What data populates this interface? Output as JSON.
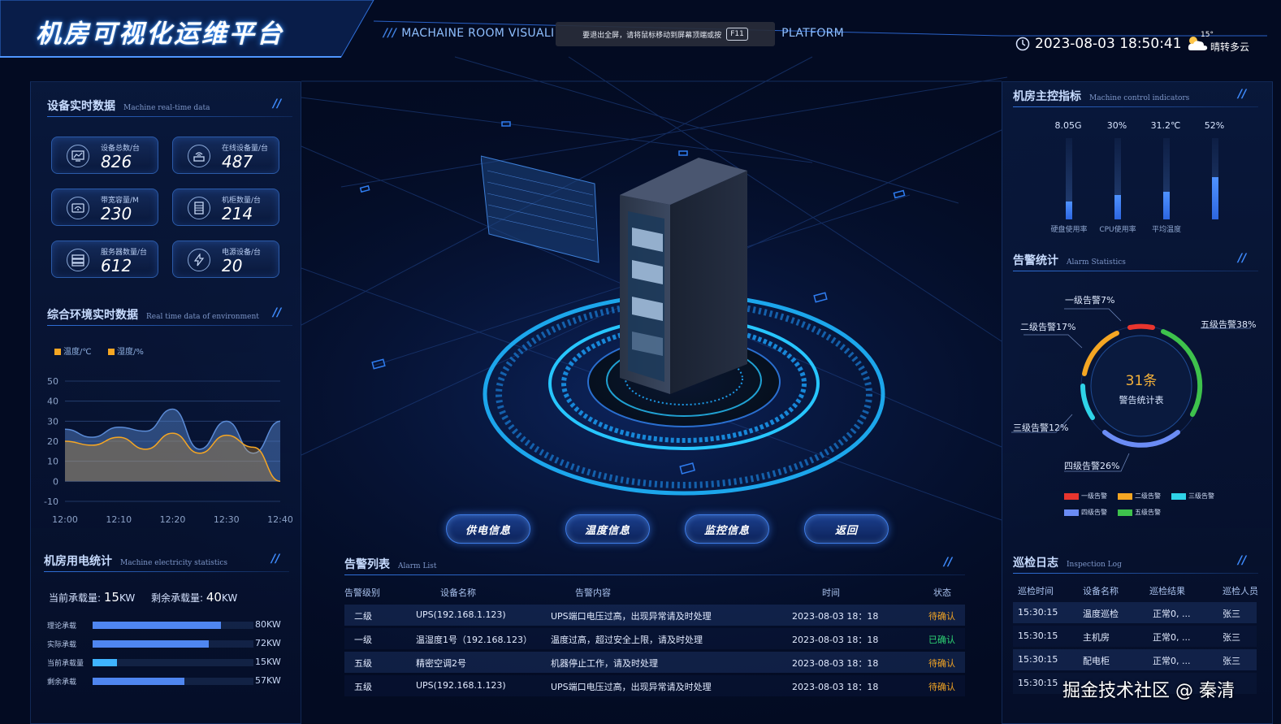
{
  "header": {
    "title": "机房可视化运维平台",
    "subtitle_left": "MACHAINE ROOM VISUALI",
    "subtitle_right": "PLATFORM",
    "fullscreen_notice": "要退出全屏，请将鼠标移动到屏幕顶端或按",
    "fullscreen_key": "F11",
    "datetime": "2023-08-03 18:50:41",
    "weather_temp": "15°",
    "weather_desc": "晴转多云"
  },
  "device_realtime": {
    "title": "设备实时数据",
    "title_en": "Machine real-time data",
    "cards": [
      {
        "label": "设备总数/台",
        "value": "826",
        "icon": "monitor-chart-icon"
      },
      {
        "label": "在线设备量/台",
        "value": "487",
        "icon": "router-icon"
      },
      {
        "label": "带宽容量/M",
        "value": "230",
        "icon": "bandwidth-icon"
      },
      {
        "label": "机柜数量/台",
        "value": "214",
        "icon": "cabinet-icon"
      },
      {
        "label": "服务器数量/台",
        "value": "612",
        "icon": "server-icon"
      },
      {
        "label": "电源设备/台",
        "value": "20",
        "icon": "power-icon"
      }
    ]
  },
  "environment": {
    "title": "综合环境实时数据",
    "title_en": "Real time data of environment",
    "legend_temp": "温度/℃",
    "legend_humidity": "湿度/%",
    "color_temp": "#f5a623",
    "color_humidity": "#5b8bd6"
  },
  "chart_data": {
    "type": "area",
    "x": [
      "12:00",
      "12:05",
      "12:10",
      "12:15",
      "12:20",
      "12:25",
      "12:30",
      "12:35",
      "12:40"
    ],
    "series": [
      {
        "name": "温度/℃",
        "values": [
          20,
          18,
          22,
          16,
          24,
          14,
          23,
          17,
          0
        ]
      },
      {
        "name": "湿度/%",
        "values": [
          26,
          22,
          27,
          25,
          36,
          16,
          30,
          14,
          30
        ]
      }
    ],
    "yticks": [
      50,
      40,
      30,
      20,
      10,
      0,
      -10
    ],
    "xticks": [
      "12:00",
      "12:10",
      "12:20",
      "12:30",
      "12:40"
    ],
    "ylim": [
      -10,
      50
    ],
    "grid": true
  },
  "electricity": {
    "title": "机房用电统计",
    "title_en": "Machine electricity statistics",
    "current_label": "当前承载量:",
    "current_value": "15",
    "current_unit": "KW",
    "remain_label": "剩余承载量:",
    "remain_value": "40",
    "remain_unit": "KW",
    "rows": [
      {
        "label": "理论承载",
        "value": 80,
        "display": "80KW",
        "color": "#4f86f0"
      },
      {
        "label": "实际承载",
        "value": 72,
        "display": "72KW",
        "color": "#4f86f0"
      },
      {
        "label": "当前承载量",
        "value": 15,
        "display": "15KW",
        "color": "#3fb4ff"
      },
      {
        "label": "剩余承载",
        "value": 57,
        "display": "57KW",
        "color": "#4f86f0"
      }
    ],
    "max": 100
  },
  "indicators": {
    "title": "机房主控指标",
    "title_en": "Machine control indicators",
    "items": [
      {
        "value": "8.05G",
        "name": "硬盘使用率",
        "fraction": 0.22
      },
      {
        "value": "30%",
        "name": "CPU使用率",
        "fraction": 0.3
      },
      {
        "value": "31.2℃",
        "name": "平均温度",
        "fraction": 0.34
      },
      {
        "value": "52%",
        "name": "",
        "fraction": 0.52
      }
    ]
  },
  "alarm_stats": {
    "title": "告警统计",
    "title_en": "Alarm Statistics",
    "total": "31条",
    "center_label": "警告统计表",
    "labels": {
      "l1": "一级告警7%",
      "l2": "二级告警17%",
      "l3": "三级告警12%",
      "l4": "四级告警26%",
      "l5": "五级告警38%"
    },
    "legend": [
      {
        "name": "一级告警",
        "color": "#e8352e"
      },
      {
        "name": "二级告警",
        "color": "#f5a623"
      },
      {
        "name": "三级告警",
        "color": "#2fd3e8"
      },
      {
        "name": "四级告警",
        "color": "#6b8cf5"
      },
      {
        "name": "五级告警",
        "color": "#3ec24c"
      }
    ]
  },
  "alarm_list": {
    "title": "告警列表",
    "title_en": "Alarm List",
    "headers": [
      "告警级别",
      "设备名称",
      "告警内容",
      "时间",
      "状态"
    ],
    "rows": [
      {
        "level": "二级",
        "device": "UPS(192.168.1.123)",
        "content": "UPS端口电压过高，出现异常请及时处理",
        "time": "2023-08-03  18：18",
        "status": "待确认",
        "done": false
      },
      {
        "level": "一级",
        "device": "温湿度1号（192.168.123）",
        "content": "温度过高，超过安全上限，请及时处理",
        "time": "2023-08-03  18：18",
        "status": "已确认",
        "done": true
      },
      {
        "level": "五级",
        "device": "精密空调2号",
        "content": "机器停止工作，请及时处理",
        "time": "2023-08-03  18：18",
        "status": "待确认",
        "done": false
      },
      {
        "level": "五级",
        "device": "UPS(192.168.1.123)",
        "content": "UPS端口电压过高，出现异常请及时处理",
        "time": "2023-08-03  18：18",
        "status": "待确认",
        "done": false
      }
    ]
  },
  "inspection": {
    "title": "巡检日志",
    "title_en": "Inspection Log",
    "headers": [
      "巡检时间",
      "设备名称",
      "巡检结果",
      "巡检人员"
    ],
    "rows": [
      {
        "time": "15:30:15",
        "device": "温度巡检",
        "result": "正常0, ...",
        "person": "张三"
      },
      {
        "time": "15:30:15",
        "device": "主机房",
        "result": "正常0, ...",
        "person": "张三"
      },
      {
        "time": "15:30:15",
        "device": "配电柜",
        "result": "正常0, ...",
        "person": "张三"
      },
      {
        "time": "15:30:15",
        "device": "",
        "result": "",
        "person": ""
      }
    ]
  },
  "buttons": {
    "power": "供电信息",
    "temperature": "温度信息",
    "monitor": "监控信息",
    "back": "返回"
  },
  "watermark": "掘金技术社区 @ 秦清"
}
